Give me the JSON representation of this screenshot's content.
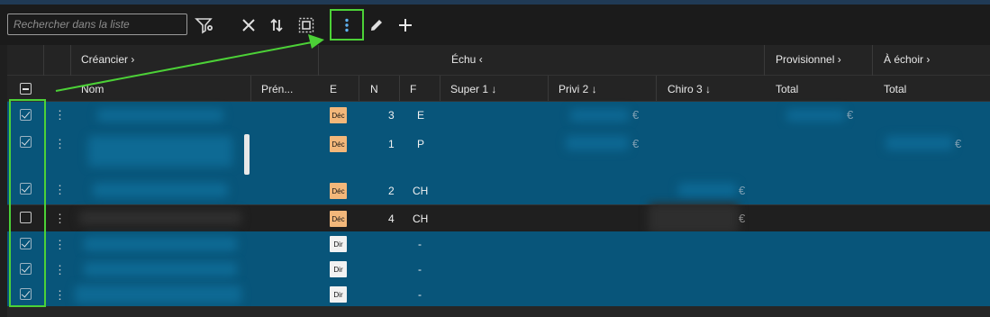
{
  "toolbar": {
    "search_placeholder": "Rechercher dans la liste",
    "icons": [
      "filter-settings-icon",
      "close-icon",
      "sort-icon",
      "select-all-icon",
      "more-vert-icon",
      "edit-icon",
      "add-icon"
    ]
  },
  "groups": {
    "creancier": "Créancier",
    "echu": "Échu",
    "provisionnel": "Provisionnel",
    "a_echoir": "À échoir"
  },
  "columns": {
    "nom": "Nom",
    "prenom": "Prén...",
    "e": "E",
    "n": "N",
    "f": "F",
    "super1": "Super 1",
    "privi2": "Privi 2",
    "chiro3": "Chiro 3",
    "total_prov": "Total",
    "total_echoir": "Total"
  },
  "rows": [
    {
      "checked": true,
      "badge": "Déc",
      "n": "3",
      "f": "E"
    },
    {
      "checked": true,
      "badge": "Déc",
      "n": "1",
      "f": "P"
    },
    {
      "checked": true,
      "badge": "Déc",
      "n": "2",
      "f": "CH"
    },
    {
      "checked": false,
      "badge": "Déc",
      "n": "4",
      "f": "CH"
    },
    {
      "checked": true,
      "badge": "Dir",
      "n": "",
      "f": "-"
    },
    {
      "checked": true,
      "badge": "Dir",
      "n": "",
      "f": "-"
    },
    {
      "checked": true,
      "badge": "Dir",
      "n": "",
      "f": "-"
    }
  ],
  "currency": "€",
  "colors": {
    "selected_row": "#08557a",
    "highlight": "#4cd137",
    "badge_dec": "#f3b77a",
    "badge_dir": "#f2f2f2",
    "more_icon": "#5fb2f0"
  }
}
